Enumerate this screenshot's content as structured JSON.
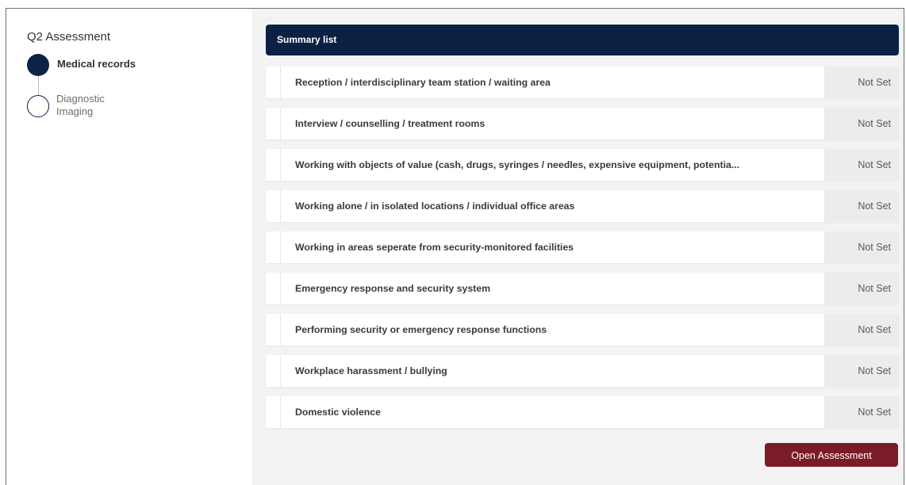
{
  "sidebar": {
    "title": "Q2 Assessment",
    "steps": [
      {
        "label": "Medical records",
        "state": "completed"
      },
      {
        "label": "Diagnostic Imaging",
        "state": "pending"
      }
    ]
  },
  "main": {
    "header": "Summary list",
    "items": [
      {
        "label": "Reception / interdisciplinary team station / waiting area",
        "status": "Not Set"
      },
      {
        "label": "Interview / counselling / treatment rooms",
        "status": "Not Set"
      },
      {
        "label": "Working with objects of value (cash, drugs, syringes / needles, expensive equipment, potentia...",
        "status": "Not Set"
      },
      {
        "label": "Working alone / in isolated locations / individual office areas",
        "status": "Not Set"
      },
      {
        "label": "Working in areas seperate from security-monitored facilities",
        "status": "Not Set"
      },
      {
        "label": "Emergency response and security system",
        "status": "Not Set"
      },
      {
        "label": "Performing security or emergency response functions",
        "status": "Not Set"
      },
      {
        "label": "Workplace harassment / bullying",
        "status": "Not Set"
      },
      {
        "label": "Domestic violence",
        "status": "Not Set"
      }
    ],
    "open_button": "Open Assessment"
  },
  "colors": {
    "header_bg": "#0b2144",
    "step_fill": "#0d2345",
    "button_bg": "#7a1b27",
    "main_bg": "#f3f3f4"
  }
}
